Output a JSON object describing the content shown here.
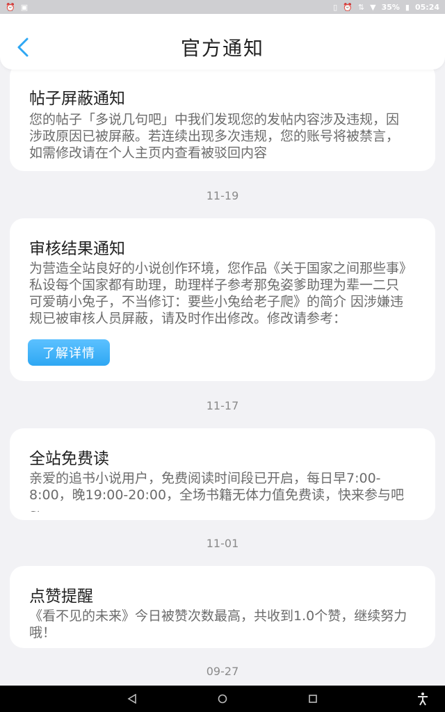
{
  "status_bar": {
    "battery_percent": "35%",
    "time": "05:24"
  },
  "header": {
    "title": "官方通知"
  },
  "notifications": [
    {
      "title": "帖子屏蔽通知",
      "body": "您的帖子「多说几句吧」中我们发现您的发帖内容涉及违规，因涉政原因已被屏蔽。若连续出现多次违规，您的账号将被禁言，如需修改请在个人主页内查看被驳回内容"
    },
    {
      "title": "审核结果通知",
      "body": "为营造全站良好的小说创作环境，您作品《关于国家之间那些事》私设每个国家都有助理，助理样子参考那兔姿爹助理为辈一二只可爱萌小兔子，不当修订：要些小兔给老子爬》的简介 因涉嫌违规已被审核人员屏蔽，请及时作出修改。修改请参考：",
      "button": "了解详情"
    },
    {
      "title": "全站免费读",
      "body": "亲爱的追书小说用户，免费阅读时间段已开启，每日早7:00-8:00，晚19:00-20:00，全场书籍无体力值免费读，快来参与吧~"
    },
    {
      "title": "点赞提醒",
      "body": "《看不见的未来》今日被赞次数最高，共收到1.0个赞，继续努力哦！"
    }
  ],
  "dates": [
    "11-19",
    "11-17",
    "11-01",
    "09-27"
  ],
  "colors": {
    "accent": "#2ea7f3",
    "background": "#f2f2f5",
    "card": "#ffffff"
  }
}
